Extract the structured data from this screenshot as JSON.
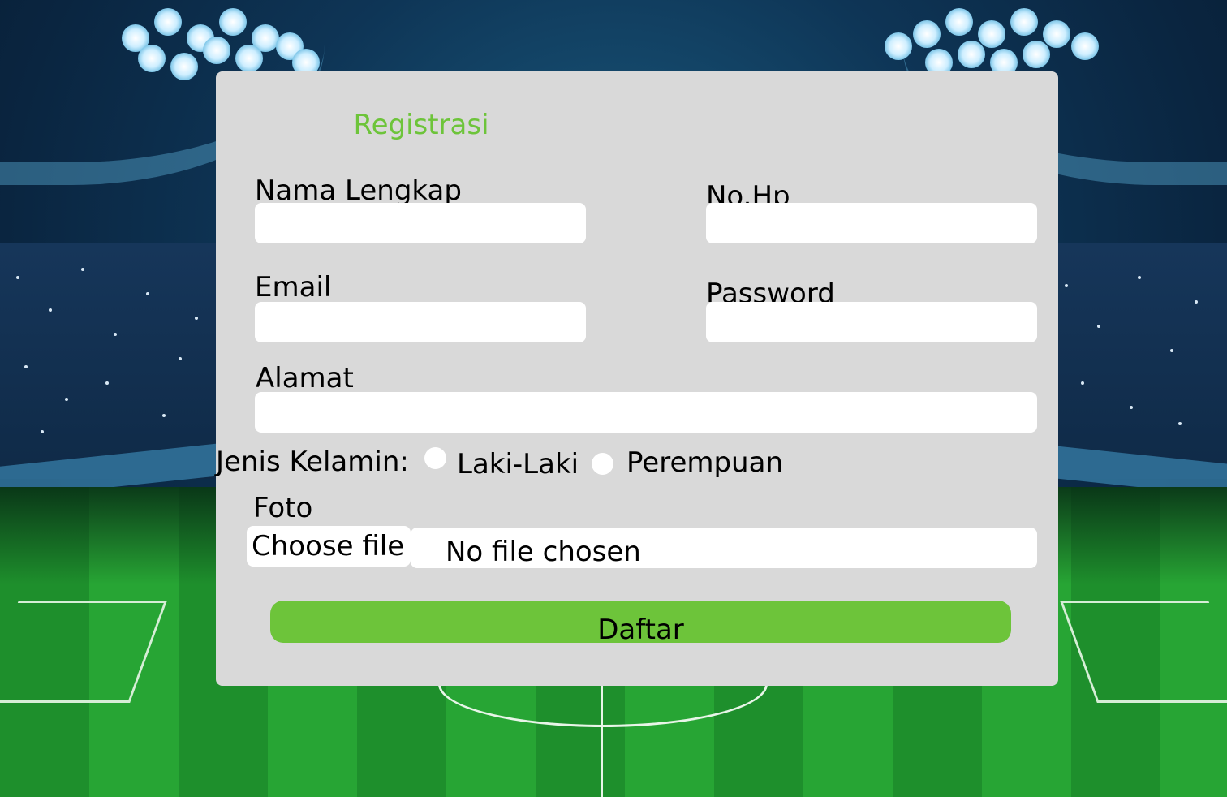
{
  "form": {
    "title": "Registrasi",
    "fields": {
      "nama_lengkap": {
        "label": "Nama Lengkap",
        "value": ""
      },
      "no_hp": {
        "label": "No.Hp",
        "value": ""
      },
      "email": {
        "label": "Email",
        "value": ""
      },
      "password": {
        "label": "Password",
        "value": ""
      },
      "alamat": {
        "label": "Alamat",
        "value": ""
      }
    },
    "gender": {
      "label": "Jenis Kelamin:",
      "options": [
        "Laki-Laki",
        "Perempuan"
      ]
    },
    "photo": {
      "label": "Foto",
      "button_label": "Choose file",
      "status": "No file chosen"
    },
    "submit_label": "Daftar"
  },
  "colors": {
    "accent": "#6dc43a",
    "card_background": "#d9d9d9",
    "input_background": "#ffffff"
  }
}
